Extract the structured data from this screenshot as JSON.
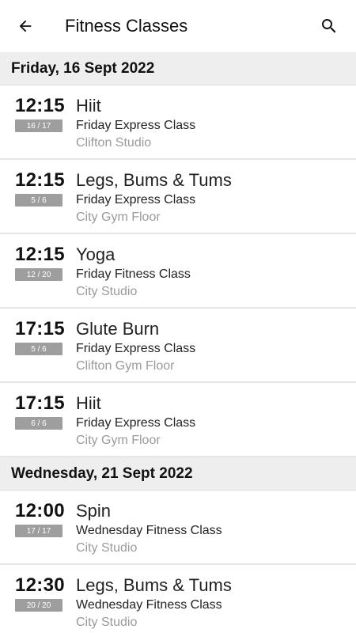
{
  "app_bar": {
    "title": "Fitness Classes",
    "back_icon": "arrow-left-icon",
    "search_icon": "search-icon"
  },
  "days": [
    {
      "date": "Friday, 16 Sept 2022",
      "classes": [
        {
          "time": "12:15",
          "spaces": "16 / 17",
          "name": "Hiit",
          "class_type": "Friday Express Class",
          "location": "Clifton Studio"
        },
        {
          "time": "12:15",
          "spaces": "5 / 6",
          "name": "Legs, Bums & Tums",
          "class_type": "Friday Express Class",
          "location": "City Gym Floor"
        },
        {
          "time": "12:15",
          "spaces": "12 / 20",
          "name": "Yoga",
          "class_type": "Friday Fitness Class",
          "location": "City Studio"
        },
        {
          "time": "17:15",
          "spaces": "5 / 6",
          "name": "Glute Burn",
          "class_type": "Friday Express Class",
          "location": "Clifton Gym Floor"
        },
        {
          "time": "17:15",
          "spaces": "6 / 6",
          "name": "Hiit",
          "class_type": "Friday Express Class",
          "location": "City Gym Floor"
        }
      ]
    },
    {
      "date": "Wednesday, 21 Sept 2022",
      "classes": [
        {
          "time": "12:00",
          "spaces": "17 / 17",
          "name": "Spin",
          "class_type": "Wednesday Fitness Class",
          "location": "City Studio"
        },
        {
          "time": "12:30",
          "spaces": "20 / 20",
          "name": "Legs, Bums & Tums",
          "class_type": "Wednesday Fitness Class",
          "location": "City Studio"
        }
      ]
    }
  ]
}
